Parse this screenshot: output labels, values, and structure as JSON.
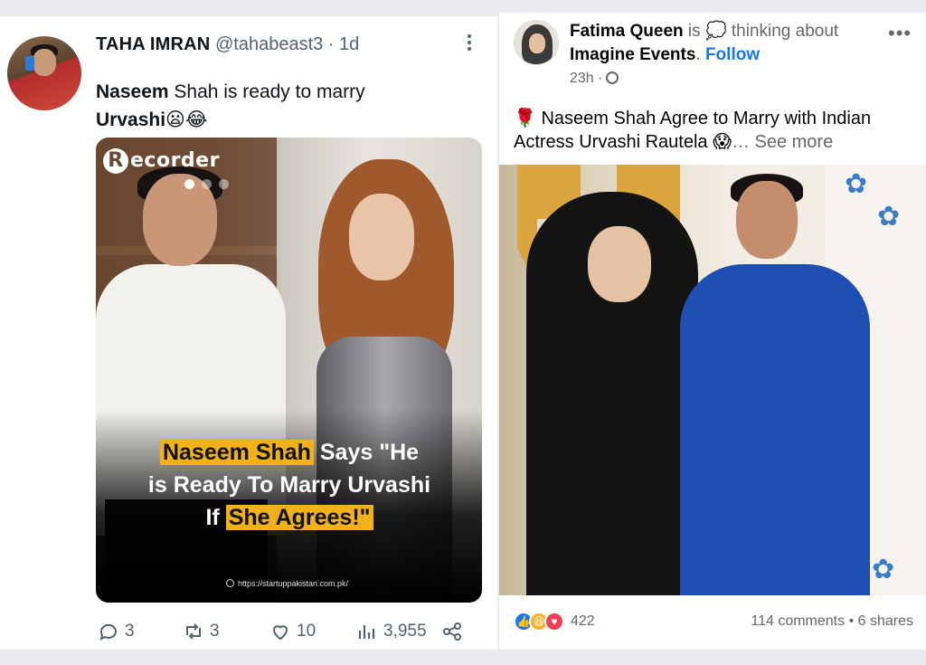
{
  "tweet": {
    "name": "TAHA IMRAN",
    "handle": "@tahabeast3",
    "time": "· 1d",
    "text_bold_1": "Naseem",
    "text_rest_1": " Shah is ready to marry",
    "text_bold_2": "Urvashi",
    "text_emoji": "😦😂",
    "media": {
      "brand": "ecorder",
      "brand_initial": "R",
      "headline_hl_1": "Naseem Shah",
      "headline_1": " Says \"He",
      "headline_2": "is Ready To Marry Urvashi",
      "headline_3": "If ",
      "headline_hl_2": "She Agrees!\"",
      "source_url": "https://startuppakistan.com.pk/"
    },
    "actions": {
      "replies": "3",
      "retweets": "3",
      "likes": "10",
      "views": "3,955"
    }
  },
  "fb": {
    "author": "Fatima Queen",
    "is": " is ",
    "thinking_emoji": "💭",
    "thinking": " thinking about",
    "page": "Imagine Events",
    "dot": ". ",
    "follow": "Follow",
    "more": "•••",
    "time": "23h ·",
    "text_emoji": "🌹",
    "text": " Naseem Shah  Agree to Marry with Indian Actress Urvashi Rautela ",
    "text_emoji_2": "😱",
    "see_more": "… See more",
    "reactions_count": "422",
    "comments": "114 comments",
    "shares_sep": " • ",
    "shares": "6 shares"
  }
}
